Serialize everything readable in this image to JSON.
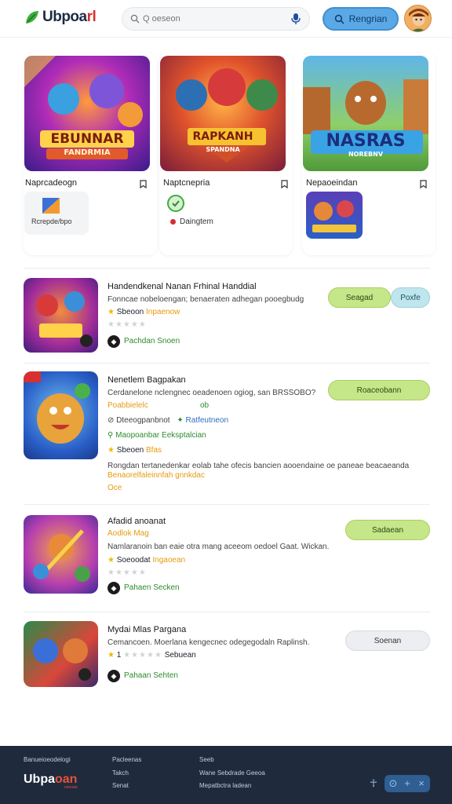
{
  "header": {
    "logo_main": "Ubpoa",
    "logo_accent": "rl",
    "search_placeholder": "Q oeseon",
    "signin_label": "Rengrian"
  },
  "featured": [
    {
      "art_title": "EBUNNAR",
      "art_subtitle": "FANDRMIA",
      "title": "Naprcadeogn",
      "sub_label": "Rcrepde/bpo"
    },
    {
      "art_title": "RAPKANH",
      "art_subtitle": "SPANDNA",
      "title": "Naptcnepria",
      "sub_label": "Daingtem"
    },
    {
      "art_title": "NASRAS",
      "art_subtitle": "NOREBNV",
      "title": "Nepaoeindan",
      "sub_label": ""
    }
  ],
  "list": [
    {
      "title": "Handendkenal Nanan Frhinal Handdial",
      "desc": "Fonncae nobeloengan; benaeraten adhegan pooegbudg",
      "rating_text": "Sbeoon",
      "rating_tag": "Inpaenow",
      "stars_empty": "★★★★★",
      "dev": "Pachdan Snoen",
      "btn_primary": "Seagad",
      "btn_secondary": "Poxfe"
    },
    {
      "title": "Nenetlem Bagpakan",
      "desc": "Cerdanelone nclengnec oeadenoen ogiog, san BRSSOBO?",
      "tag": "Poabbielelc",
      "tag_right": "ob",
      "meta_left": "Dteeogpanbnot",
      "meta_right": "Ratfeutneon",
      "meta2": "Maopoanbar Eeksptalcian",
      "rating_text": "Sbeoen",
      "rating_tag": "Bfas",
      "long1": "Rongdan tertanedenkar eolab tahe ofecis bancien aooendaine oe paneae beacaeanda",
      "long2": "Benaorelfaleinnfah gnnkdac",
      "long3": "Oce",
      "btn_primary": "Roaceobann"
    },
    {
      "title": "Afadid anoanat",
      "subtitle": "Aodlok Mag",
      "desc": "Namlaranoin ban eaie otra mang aceeom oedoel Gaat. Wickan.",
      "rating_text": "Soeoodat",
      "rating_tag": "Ingaoean",
      "stars_empty": "★★★★★",
      "dev": "Pahaen Secken",
      "btn_primary": "Sadaean"
    },
    {
      "title": "Mydai Mlas Pargana",
      "desc": "Cemancoen. Moerlana kengecnec odegegodaln Raplinsh.",
      "rating_value": "1",
      "rating_text": "Sebuean",
      "dev": "Pahaan Sehten",
      "btn_primary": "Soenan"
    }
  ],
  "footer": {
    "col1_head": "Banueioeodelogi",
    "col2_head": "Pacleenas",
    "col2_a": "Takch",
    "col2_b": "Senat",
    "col3_head": "Seeb",
    "col3_a": "Wane Sebdrade Geeoa",
    "col3_b": "Mepatbctra ladean",
    "logo_main": "Ubpa",
    "logo_accent": "oan",
    "logo_sub": "oeonan"
  },
  "colors": {
    "accent_blue": "#5aa9e6",
    "accent_green": "#c6e68a",
    "footer_bg": "#1f2a3d"
  },
  "icons": [
    "logo-leaf-icon",
    "search-icon",
    "mic-icon",
    "search-icon",
    "bookmark-icon",
    "map-pin-icon",
    "star-icon",
    "developer-icon",
    "check-circle-icon",
    "leaf-icon",
    "person-icon",
    "info-icon",
    "plus-icon",
    "close-icon"
  ]
}
